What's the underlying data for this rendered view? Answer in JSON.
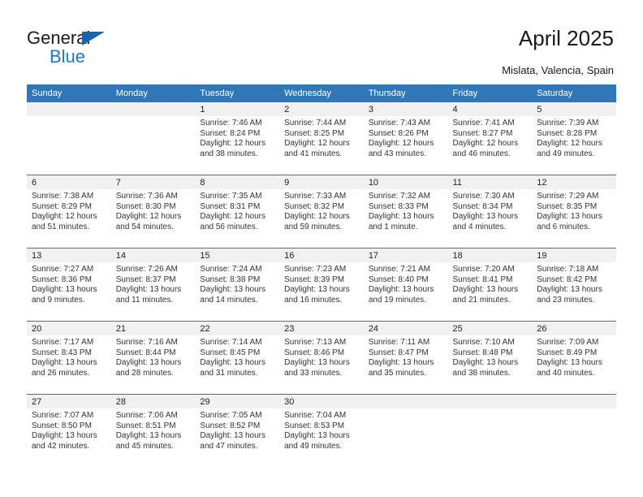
{
  "brand": {
    "name_top": "General",
    "name_bottom": "Blue"
  },
  "header": {
    "title": "April 2025",
    "subtitle": "Mislata, Valencia, Spain"
  },
  "colors": {
    "header_blue": "#3077b8",
    "logo_blue": "#1f79c4",
    "daynum_band": "#f1f1f1"
  },
  "calendar": {
    "weekday_headers": [
      "Sunday",
      "Monday",
      "Tuesday",
      "Wednesday",
      "Thursday",
      "Friday",
      "Saturday"
    ],
    "weeks": [
      [
        {
          "day": "",
          "lines": []
        },
        {
          "day": "",
          "lines": []
        },
        {
          "day": "1",
          "lines": [
            "Sunrise: 7:46 AM",
            "Sunset: 8:24 PM",
            "Daylight: 12 hours",
            "and 38 minutes."
          ]
        },
        {
          "day": "2",
          "lines": [
            "Sunrise: 7:44 AM",
            "Sunset: 8:25 PM",
            "Daylight: 12 hours",
            "and 41 minutes."
          ]
        },
        {
          "day": "3",
          "lines": [
            "Sunrise: 7:43 AM",
            "Sunset: 8:26 PM",
            "Daylight: 12 hours",
            "and 43 minutes."
          ]
        },
        {
          "day": "4",
          "lines": [
            "Sunrise: 7:41 AM",
            "Sunset: 8:27 PM",
            "Daylight: 12 hours",
            "and 46 minutes."
          ]
        },
        {
          "day": "5",
          "lines": [
            "Sunrise: 7:39 AM",
            "Sunset: 8:28 PM",
            "Daylight: 12 hours",
            "and 49 minutes."
          ]
        }
      ],
      [
        {
          "day": "6",
          "lines": [
            "Sunrise: 7:38 AM",
            "Sunset: 8:29 PM",
            "Daylight: 12 hours",
            "and 51 minutes."
          ]
        },
        {
          "day": "7",
          "lines": [
            "Sunrise: 7:36 AM",
            "Sunset: 8:30 PM",
            "Daylight: 12 hours",
            "and 54 minutes."
          ]
        },
        {
          "day": "8",
          "lines": [
            "Sunrise: 7:35 AM",
            "Sunset: 8:31 PM",
            "Daylight: 12 hours",
            "and 56 minutes."
          ]
        },
        {
          "day": "9",
          "lines": [
            "Sunrise: 7:33 AM",
            "Sunset: 8:32 PM",
            "Daylight: 12 hours",
            "and 59 minutes."
          ]
        },
        {
          "day": "10",
          "lines": [
            "Sunrise: 7:32 AM",
            "Sunset: 8:33 PM",
            "Daylight: 13 hours",
            "and 1 minute."
          ]
        },
        {
          "day": "11",
          "lines": [
            "Sunrise: 7:30 AM",
            "Sunset: 8:34 PM",
            "Daylight: 13 hours",
            "and 4 minutes."
          ]
        },
        {
          "day": "12",
          "lines": [
            "Sunrise: 7:29 AM",
            "Sunset: 8:35 PM",
            "Daylight: 13 hours",
            "and 6 minutes."
          ]
        }
      ],
      [
        {
          "day": "13",
          "lines": [
            "Sunrise: 7:27 AM",
            "Sunset: 8:36 PM",
            "Daylight: 13 hours",
            "and 9 minutes."
          ]
        },
        {
          "day": "14",
          "lines": [
            "Sunrise: 7:26 AM",
            "Sunset: 8:37 PM",
            "Daylight: 13 hours",
            "and 11 minutes."
          ]
        },
        {
          "day": "15",
          "lines": [
            "Sunrise: 7:24 AM",
            "Sunset: 8:38 PM",
            "Daylight: 13 hours",
            "and 14 minutes."
          ]
        },
        {
          "day": "16",
          "lines": [
            "Sunrise: 7:23 AM",
            "Sunset: 8:39 PM",
            "Daylight: 13 hours",
            "and 16 minutes."
          ]
        },
        {
          "day": "17",
          "lines": [
            "Sunrise: 7:21 AM",
            "Sunset: 8:40 PM",
            "Daylight: 13 hours",
            "and 19 minutes."
          ]
        },
        {
          "day": "18",
          "lines": [
            "Sunrise: 7:20 AM",
            "Sunset: 8:41 PM",
            "Daylight: 13 hours",
            "and 21 minutes."
          ]
        },
        {
          "day": "19",
          "lines": [
            "Sunrise: 7:18 AM",
            "Sunset: 8:42 PM",
            "Daylight: 13 hours",
            "and 23 minutes."
          ]
        }
      ],
      [
        {
          "day": "20",
          "lines": [
            "Sunrise: 7:17 AM",
            "Sunset: 8:43 PM",
            "Daylight: 13 hours",
            "and 26 minutes."
          ]
        },
        {
          "day": "21",
          "lines": [
            "Sunrise: 7:16 AM",
            "Sunset: 8:44 PM",
            "Daylight: 13 hours",
            "and 28 minutes."
          ]
        },
        {
          "day": "22",
          "lines": [
            "Sunrise: 7:14 AM",
            "Sunset: 8:45 PM",
            "Daylight: 13 hours",
            "and 31 minutes."
          ]
        },
        {
          "day": "23",
          "lines": [
            "Sunrise: 7:13 AM",
            "Sunset: 8:46 PM",
            "Daylight: 13 hours",
            "and 33 minutes."
          ]
        },
        {
          "day": "24",
          "lines": [
            "Sunrise: 7:11 AM",
            "Sunset: 8:47 PM",
            "Daylight: 13 hours",
            "and 35 minutes."
          ]
        },
        {
          "day": "25",
          "lines": [
            "Sunrise: 7:10 AM",
            "Sunset: 8:48 PM",
            "Daylight: 13 hours",
            "and 38 minutes."
          ]
        },
        {
          "day": "26",
          "lines": [
            "Sunrise: 7:09 AM",
            "Sunset: 8:49 PM",
            "Daylight: 13 hours",
            "and 40 minutes."
          ]
        }
      ],
      [
        {
          "day": "27",
          "lines": [
            "Sunrise: 7:07 AM",
            "Sunset: 8:50 PM",
            "Daylight: 13 hours",
            "and 42 minutes."
          ]
        },
        {
          "day": "28",
          "lines": [
            "Sunrise: 7:06 AM",
            "Sunset: 8:51 PM",
            "Daylight: 13 hours",
            "and 45 minutes."
          ]
        },
        {
          "day": "29",
          "lines": [
            "Sunrise: 7:05 AM",
            "Sunset: 8:52 PM",
            "Daylight: 13 hours",
            "and 47 minutes."
          ]
        },
        {
          "day": "30",
          "lines": [
            "Sunrise: 7:04 AM",
            "Sunset: 8:53 PM",
            "Daylight: 13 hours",
            "and 49 minutes."
          ]
        },
        {
          "day": "",
          "lines": []
        },
        {
          "day": "",
          "lines": []
        },
        {
          "day": "",
          "lines": []
        }
      ]
    ]
  }
}
